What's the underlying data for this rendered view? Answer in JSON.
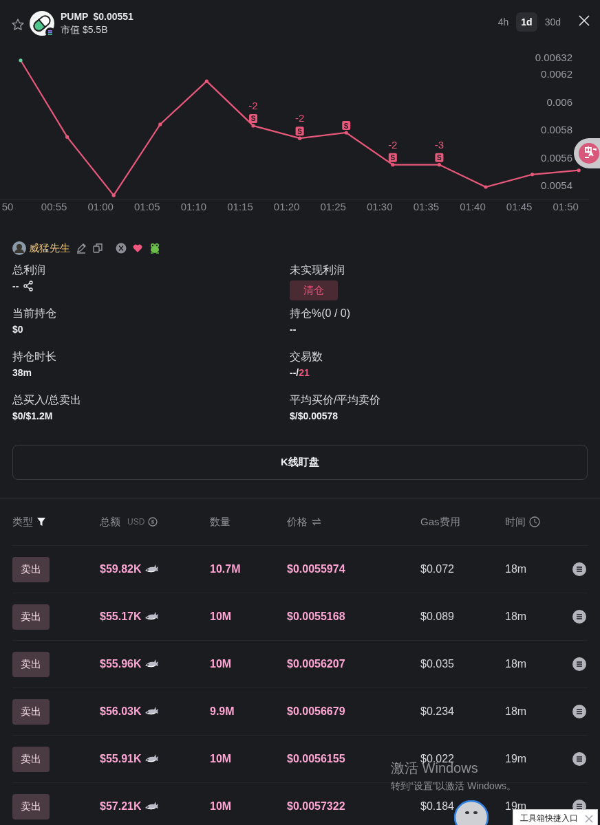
{
  "header": {
    "favorite": false,
    "symbol": "PUMP",
    "price": "$0.00551",
    "market_cap": "市值 $5.5B",
    "timeframes": [
      {
        "label": "4h",
        "selected": false
      },
      {
        "label": "1d",
        "selected": true
      },
      {
        "label": "30d",
        "selected": false
      }
    ]
  },
  "chart": {
    "chart_data": {
      "type": "line",
      "categories": [
        "50",
        "00:55",
        "01:00",
        "01:05",
        "01:10",
        "01:15",
        "01:20",
        "01:25",
        "01:30",
        "01:35",
        "01:40",
        "01:45",
        "01:50"
      ],
      "series": [
        {
          "color": "#e8587a",
          "values": [
            0.0063,
            0.00575,
            0.00533,
            0.00584,
            0.00615,
            0.00583,
            0.00574,
            0.00578,
            0.00555,
            0.00555,
            0.00539,
            0.00548,
            0.00551
          ]
        }
      ],
      "yticks": [
        0.0054,
        0.0056,
        0.0058,
        0.006,
        0.0062,
        0.00632
      ],
      "ylim": [
        0.0053,
        0.00632
      ]
    },
    "point_marks": [
      {
        "marked": false
      },
      {
        "marked": false
      },
      {
        "marked": false
      },
      {
        "marked": false
      },
      {
        "marked": false
      },
      {
        "marked": true,
        "marker": "S",
        "count": "-2"
      },
      {
        "marked": true,
        "marker": "S",
        "count": "-2"
      },
      {
        "marked": true,
        "marker": "S"
      },
      {
        "marked": true,
        "marker": "S",
        "count": "-2"
      },
      {
        "marked": true,
        "marker": "S",
        "count": "-3"
      },
      {
        "marked": false
      },
      {
        "marked": false
      },
      {
        "marked": false
      }
    ]
  },
  "profile": {
    "name": "威猛先生"
  },
  "stats": [
    {
      "label": "总利润",
      "value": "--",
      "kind": "share"
    },
    {
      "label": "未实现利润",
      "action": "清仓",
      "kind": "action"
    },
    {
      "label": "当前持仓",
      "value": "$0",
      "kind": "text"
    },
    {
      "label": "持仓%(0 / 0)",
      "value": "--",
      "kind": "text"
    },
    {
      "label": "持仓时长",
      "value": "38m",
      "kind": "text"
    },
    {
      "label": "交易数",
      "value": "--/",
      "highlight": "21",
      "kind": "split"
    },
    {
      "label": "总买入/总卖出",
      "value": "$0/$1.2M",
      "kind": "text"
    },
    {
      "label": "平均买价/平均卖价",
      "value": "$/$0.00578",
      "kind": "text"
    }
  ],
  "watch_button": "K线盯盘",
  "table": {
    "columns": [
      {
        "label": "类型"
      },
      {
        "label": "总额",
        "unit": "USD"
      },
      {
        "label": "数量"
      },
      {
        "label": "价格"
      },
      {
        "label": "Gas费用"
      },
      {
        "label": "时间"
      }
    ],
    "rows": [
      {
        "type": "卖出",
        "amount": "$59.82K",
        "quantity": "10.7M",
        "price": "$0.0055974",
        "gas": "$0.072",
        "time": "18m"
      },
      {
        "type": "卖出",
        "amount": "$55.17K",
        "quantity": "10M",
        "price": "$0.0055168",
        "gas": "$0.089",
        "time": "18m"
      },
      {
        "type": "卖出",
        "amount": "$55.96K",
        "quantity": "10M",
        "price": "$0.0056207",
        "gas": "$0.035",
        "time": "18m"
      },
      {
        "type": "卖出",
        "amount": "$56.03K",
        "quantity": "9.9M",
        "price": "$0.0056679",
        "gas": "$0.234",
        "time": "18m"
      },
      {
        "type": "卖出",
        "amount": "$55.91K",
        "quantity": "10M",
        "price": "$0.0056155",
        "gas": "$0.022",
        "time": "19m"
      },
      {
        "type": "卖出",
        "amount": "$57.21K",
        "quantity": "10M",
        "price": "$0.0057322",
        "gas": "$0.184",
        "time": "19m"
      }
    ]
  },
  "windows_notice": {
    "title": "激活 Windows",
    "subtitle": "转到“设置”以激活 Windows。"
  },
  "toolbox_tip": {
    "text": "工具箱快捷入口"
  }
}
